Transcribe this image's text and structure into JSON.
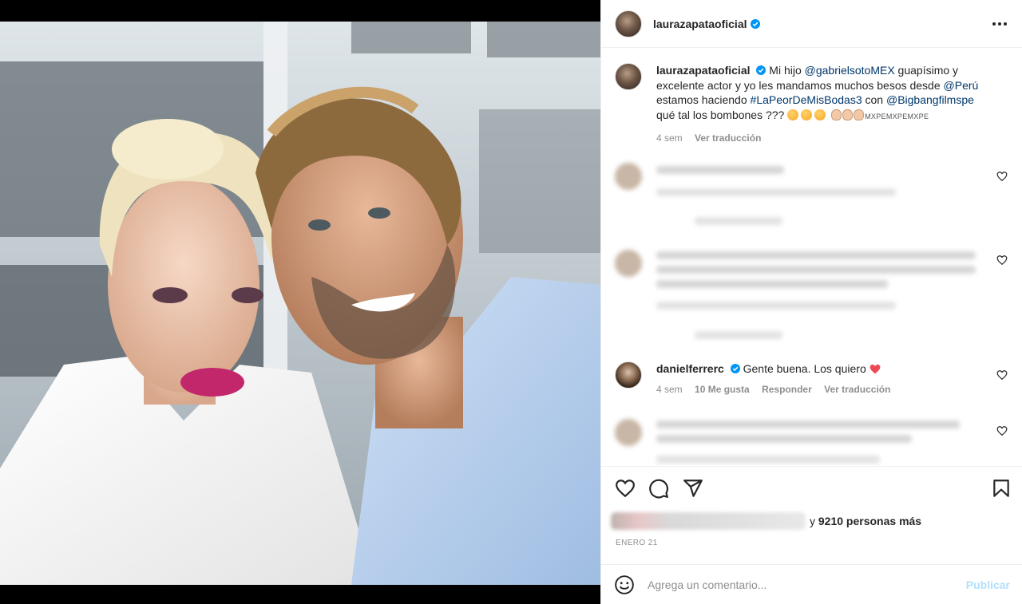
{
  "post": {
    "username": "laurazapataoficial",
    "more_icon": "more-horizontal-icon"
  },
  "caption": {
    "username": "laurazapataoficial",
    "t1": " Mi hijo ",
    "m1": "@gabrielsotoMEX",
    "t2": " guapísimo y excelente actor y yo les mandamos muchos besos desde ",
    "m2": "@Perú",
    "t3": " estamos haciendo ",
    "m3": "#LaPeorDeMisBodas3",
    "t4": " con ",
    "m4": "@Bigbangfilmspe",
    "t5": " qué tal los bombones ??? ",
    "flags": "MXPEMXPEMXPE",
    "time": "4 sem",
    "translate": "Ver traducción"
  },
  "comment_daniel": {
    "username": "danielferrerc",
    "text": "Gente buena. Los quiero",
    "time": "4 sem",
    "likes": "10 Me gusta",
    "reply": "Responder",
    "translate": "Ver traducción"
  },
  "likes": {
    "suffix_pre": "y ",
    "count": "9210 personas más"
  },
  "date": "ENERO 21",
  "composer": {
    "placeholder": "Agrega un comentario...",
    "submit": "Publicar"
  },
  "colors": {
    "link": "#00376b",
    "verified": "#0095f6",
    "publish_disabled": "#b2dffc",
    "heart_red": "#ed4956"
  }
}
